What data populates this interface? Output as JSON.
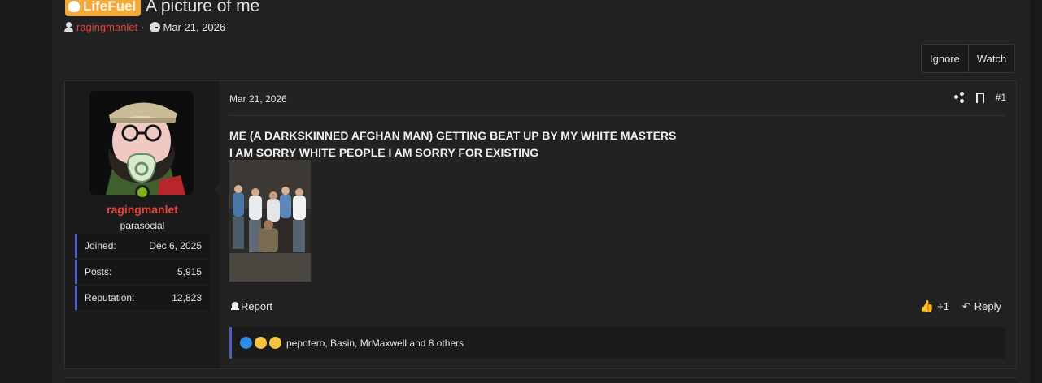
{
  "thread": {
    "prefix": "LifeFuel",
    "title": "A picture of me",
    "author": "ragingmanlet",
    "date": "Mar 21, 2026"
  },
  "actions": {
    "ignore": "Ignore",
    "watch": "Watch"
  },
  "post": {
    "date": "Mar 21, 2026",
    "number": "#1",
    "line1": "ME (A DARKSKINNED AFGHAN MAN) GETTING BEAT UP BY MY WHITE MASTERS",
    "line2": "I AM SORRY WHITE PEOPLE I AM SORRY FOR EXISTING",
    "report": "Report",
    "like_count": "+1",
    "reply": "Reply",
    "reactions_text": "pepotero, Basin, MrMaxwell and 8 others"
  },
  "user": {
    "name": "ragingmanlet",
    "title": "parasocial",
    "stats": [
      {
        "label": "Joined:",
        "value": "Dec 6, 2025"
      },
      {
        "label": "Posts:",
        "value": "5,915"
      },
      {
        "label": "Reputation:",
        "value": "12,823"
      }
    ]
  },
  "colors": {
    "accent_red": "#e0453a",
    "prefix_orange": "#f2a93b",
    "stat_border": "#4e5fc4",
    "online": "#7cb518"
  }
}
